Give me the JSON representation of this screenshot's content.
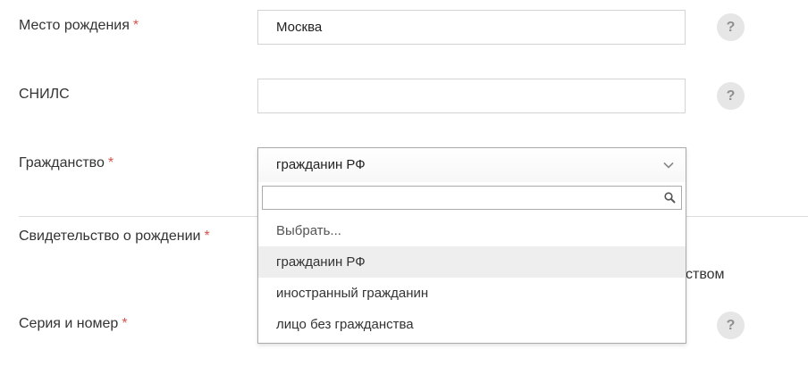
{
  "fields": {
    "birthplace": {
      "label": "Место рождения",
      "required_mark": "*",
      "value": "Москва",
      "help": "?"
    },
    "snils": {
      "label": "СНИЛС",
      "value": "",
      "help": "?"
    },
    "citizenship": {
      "label": "Гражданство",
      "required_mark": "*",
      "selected": "гражданин РФ",
      "search_value": "",
      "options": [
        "Выбрать...",
        "гражданин РФ",
        "иностранный гражданин",
        "лицо без гражданства"
      ]
    },
    "birth_certificate": {
      "label": "Свидетельство о рождении",
      "required_mark": "*",
      "partial_text": "ством"
    },
    "series_number": {
      "label": "Серия и номер",
      "required_mark": "*",
      "help": "?"
    }
  },
  "colors": {
    "required": "#d9534f",
    "help_bg": "#e6e6e6",
    "selected_option_bg": "#eeeeee"
  },
  "icons": {
    "dropdown": "chevron-down-icon",
    "search": "search-icon",
    "help": "question-icon"
  }
}
